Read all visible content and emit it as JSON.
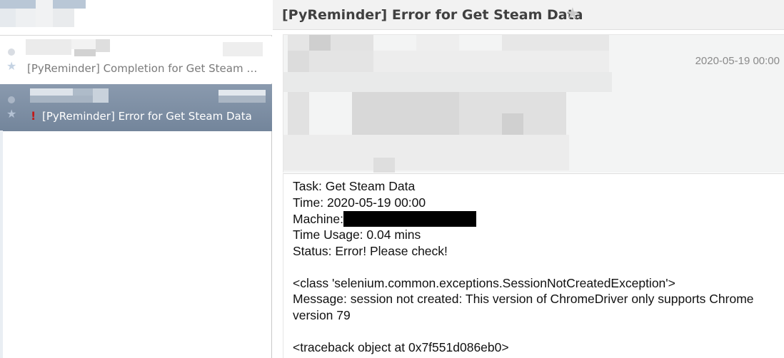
{
  "message_list": {
    "messages": [
      {
        "subject": "[PyReminder] Completion for Get Steam Da...",
        "selected": false,
        "important": false
      },
      {
        "subject": "[PyReminder] Error for Get Steam Data",
        "selected": true,
        "important": true
      }
    ],
    "icons": {
      "unread": "unread-dot-icon",
      "star": "star-icon",
      "important": "exclamation-icon"
    },
    "colors": {
      "selected_row": "#7f90a5",
      "important": "#c21818"
    }
  },
  "reading_pane": {
    "subject": "[PyReminder] Error for Get Steam Data",
    "header": {
      "date": "2020-05-19 00:00"
    },
    "body": {
      "task": "Task: Get Steam Data",
      "time": "Time: 2020-05-19 00:00",
      "machine_label": "Machine:",
      "time_usage": "Time Usage: 0.04 mins",
      "status": "Status: Error! Please check!",
      "exception_class": "<class 'selenium.common.exceptions.SessionNotCreatedException'>",
      "message_line_1": "Message: session not created: This version of ChromeDriver only supports Chrome",
      "message_line_2": "version 79",
      "traceback": "<traceback object at 0x7f551d086eb0>"
    }
  }
}
